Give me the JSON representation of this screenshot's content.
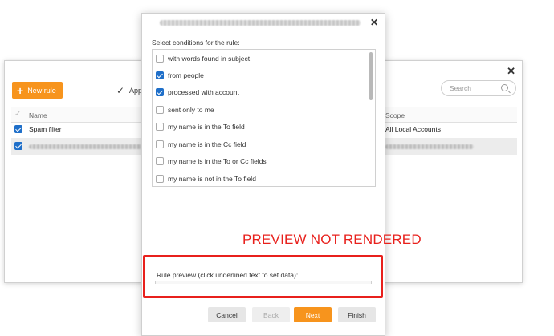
{
  "rules_window": {
    "new_rule_label": "New rule",
    "apply_label": "Appl",
    "search_placeholder": "Search",
    "columns": {
      "name": "Name",
      "scope": "Scope"
    },
    "rows": [
      {
        "name": "Spam filter",
        "scope": "All Local Accounts",
        "checked": true
      },
      {
        "name": "",
        "scope": "",
        "checked": true,
        "redacted": true
      }
    ]
  },
  "dialog": {
    "conditions_label": "Select conditions for the rule:",
    "conditions": [
      {
        "label": "with words found in subject",
        "checked": false
      },
      {
        "label": "from people",
        "checked": true
      },
      {
        "label": "processed with account",
        "checked": true
      },
      {
        "label": "sent only to me",
        "checked": false
      },
      {
        "label": "my name is in the To field",
        "checked": false
      },
      {
        "label": "my name is in the Cc field",
        "checked": false
      },
      {
        "label": "my name is in the To or Cc fields",
        "checked": false
      },
      {
        "label": "my name is not in the To field",
        "checked": false
      }
    ],
    "overlay_text": "PREVIEW NOT RENDERED",
    "preview_label": "Rule preview (click underlined text to set data):",
    "buttons": {
      "cancel": "Cancel",
      "back": "Back",
      "next": "Next",
      "finish": "Finish"
    }
  },
  "colors": {
    "accent": "#f7941d",
    "check": "#1f6fc9",
    "annotation": "#e8201c"
  }
}
